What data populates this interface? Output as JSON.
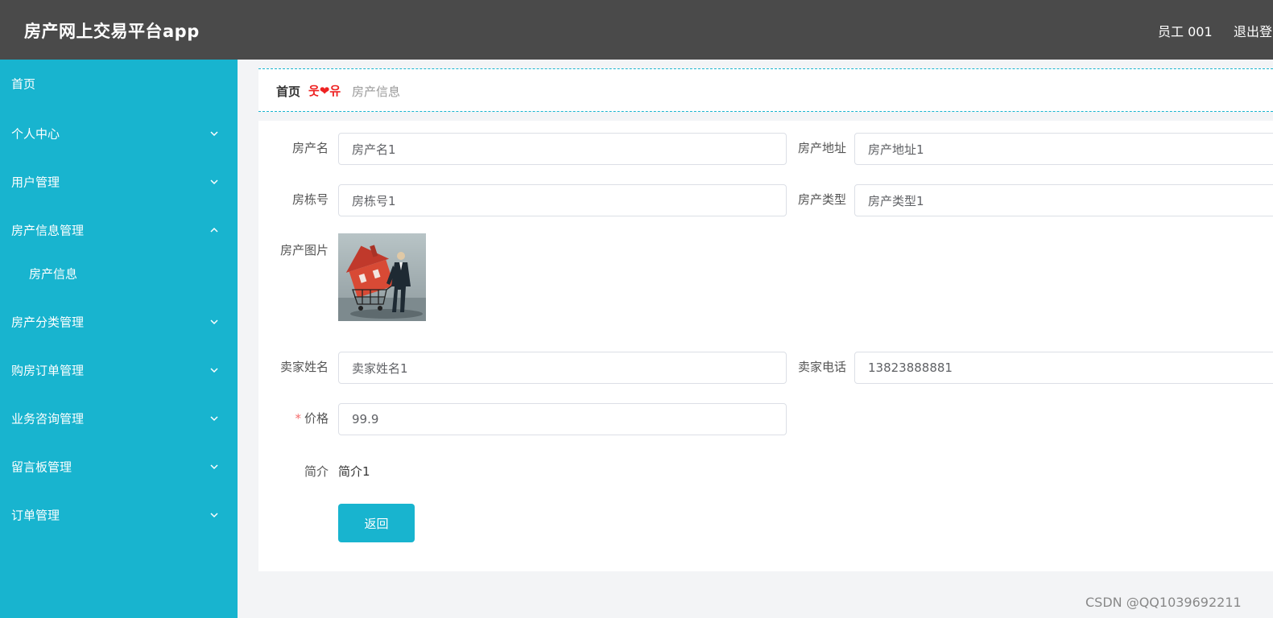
{
  "header": {
    "title": "房产网上交易平台app",
    "user": "员工 001",
    "logout": "退出登"
  },
  "sidebar": {
    "items": [
      {
        "label": "首页"
      },
      {
        "label": "个人中心"
      },
      {
        "label": "用户管理"
      },
      {
        "label": "房产信息管理"
      },
      {
        "label": "房产信息"
      },
      {
        "label": "房产分类管理"
      },
      {
        "label": "购房订单管理"
      },
      {
        "label": "业务咨询管理"
      },
      {
        "label": "留言板管理"
      },
      {
        "label": "订单管理"
      }
    ]
  },
  "breadcrumb": {
    "home": "首页",
    "separator": "웃❤유",
    "current": "房产信息"
  },
  "form": {
    "name_label": "房产名",
    "name_value": "房产名1",
    "address_label": "房产地址",
    "address_value": "房产地址1",
    "building_label": "房栋号",
    "building_value": "房栋号1",
    "type_label": "房产类型",
    "type_value": "房产类型1",
    "image_label": "房产图片",
    "seller_name_label": "卖家姓名",
    "seller_name_value": "卖家姓名1",
    "seller_phone_label": "卖家电话",
    "seller_phone_value": "13823888881",
    "price_required": "*",
    "price_label": "价格",
    "price_value": "99.9",
    "intro_label": "简介",
    "intro_value": "简介1",
    "back_button": "返回"
  },
  "watermark": "CSDN @QQ1039692211",
  "colors": {
    "topbar": "#4a4a4a",
    "sidebar": "#18b4cf",
    "accent": "#18b4cf"
  }
}
